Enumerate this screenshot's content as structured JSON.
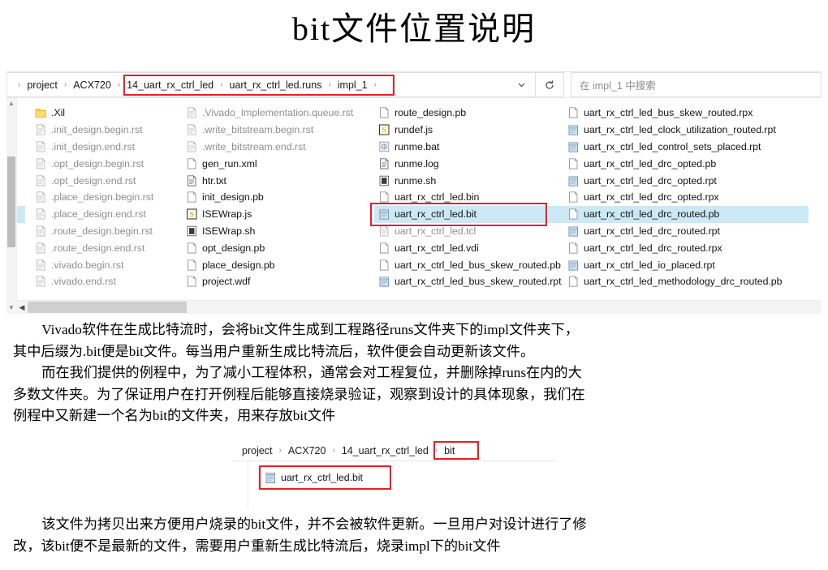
{
  "title": "bit文件位置说明",
  "explorer1": {
    "breadcrumbs": [
      {
        "label": "project",
        "highlighted": false
      },
      {
        "label": "ACX720",
        "highlighted": false
      },
      {
        "label": "14_uart_rx_ctrl_led",
        "highlighted": true
      },
      {
        "label": "uart_rx_ctrl_led.runs",
        "highlighted": true
      },
      {
        "label": "impl_1",
        "highlighted": true
      }
    ],
    "dropdown_icon": "chevron-down-icon",
    "refresh_icon": "refresh-icon",
    "search_placeholder": "在 impl_1 中搜索",
    "columns": [
      {
        "items": [
          {
            "name": ".Xil",
            "icon": "folder-icon",
            "dim": false
          },
          {
            "name": ".init_design.begin.rst",
            "icon": "rst-file-icon",
            "dim": true
          },
          {
            "name": ".init_design.end.rst",
            "icon": "rst-file-icon",
            "dim": true
          },
          {
            "name": ".opt_design.begin.rst",
            "icon": "rst-file-icon",
            "dim": true
          },
          {
            "name": ".opt_design.end.rst",
            "icon": "rst-file-icon",
            "dim": true
          },
          {
            "name": ".place_design.begin.rst",
            "icon": "rst-file-icon",
            "dim": true
          },
          {
            "name": ".place_design.end.rst",
            "icon": "rst-file-icon",
            "dim": true
          },
          {
            "name": ".route_design.begin.rst",
            "icon": "rst-file-icon",
            "dim": true
          },
          {
            "name": ".route_design.end.rst",
            "icon": "rst-file-icon",
            "dim": true
          },
          {
            "name": ".vivado.begin.rst",
            "icon": "rst-file-icon",
            "dim": true
          },
          {
            "name": ".vivado.end.rst",
            "icon": "rst-file-icon",
            "dim": true
          }
        ]
      },
      {
        "items": [
          {
            "name": ".Vivado_Implementation.queue.rst",
            "icon": "rst-file-icon",
            "dim": true
          },
          {
            "name": ".write_bitstream.begin.rst",
            "icon": "rst-file-icon",
            "dim": true
          },
          {
            "name": ".write_bitstream.end.rst",
            "icon": "rst-file-icon",
            "dim": true
          },
          {
            "name": "gen_run.xml",
            "icon": "blank-file-icon",
            "dim": false
          },
          {
            "name": "htr.txt",
            "icon": "text-file-icon",
            "dim": false
          },
          {
            "name": "init_design.pb",
            "icon": "blank-file-icon",
            "dim": false
          },
          {
            "name": "ISEWrap.js",
            "icon": "js-file-icon",
            "dim": false
          },
          {
            "name": "ISEWrap.sh",
            "icon": "sh-file-icon",
            "dim": false
          },
          {
            "name": "opt_design.pb",
            "icon": "blank-file-icon",
            "dim": false
          },
          {
            "name": "place_design.pb",
            "icon": "blank-file-icon",
            "dim": false
          },
          {
            "name": "project.wdf",
            "icon": "blank-file-icon",
            "dim": false
          }
        ]
      },
      {
        "items": [
          {
            "name": "route_design.pb",
            "icon": "blank-file-icon",
            "dim": false
          },
          {
            "name": "rundef.js",
            "icon": "js-file-icon",
            "dim": false
          },
          {
            "name": "runme.bat",
            "icon": "bat-file-icon",
            "dim": false
          },
          {
            "name": "runme.log",
            "icon": "text-file-icon",
            "dim": false
          },
          {
            "name": "runme.sh",
            "icon": "sh-file-icon",
            "dim": false
          },
          {
            "name": "uart_rx_ctrl_led.bin",
            "icon": "blank-file-icon",
            "dim": false
          },
          {
            "name": "uart_rx_ctrl_led.bit",
            "icon": "notepad-file-icon",
            "dim": false,
            "selected": true
          },
          {
            "name": "uart_rx_ctrl_led.tcl",
            "icon": "rst-file-icon",
            "dim": true
          },
          {
            "name": "uart_rx_ctrl_led.vdi",
            "icon": "blank-file-icon",
            "dim": false
          },
          {
            "name": "uart_rx_ctrl_led_bus_skew_routed.pb",
            "icon": "blank-file-icon",
            "dim": false
          },
          {
            "name": "uart_rx_ctrl_led_bus_skew_routed.rpt",
            "icon": "notepad-file-icon",
            "dim": false
          }
        ]
      },
      {
        "items": [
          {
            "name": "uart_rx_ctrl_led_bus_skew_routed.rpx",
            "icon": "blank-file-icon",
            "dim": false
          },
          {
            "name": "uart_rx_ctrl_led_clock_utilization_routed.rpt",
            "icon": "notepad-file-icon",
            "dim": false
          },
          {
            "name": "uart_rx_ctrl_led_control_sets_placed.rpt",
            "icon": "notepad-file-icon",
            "dim": false
          },
          {
            "name": "uart_rx_ctrl_led_drc_opted.pb",
            "icon": "blank-file-icon",
            "dim": false
          },
          {
            "name": "uart_rx_ctrl_led_drc_opted.rpt",
            "icon": "notepad-file-icon",
            "dim": false
          },
          {
            "name": "uart_rx_ctrl_led_drc_opted.rpx",
            "icon": "blank-file-icon",
            "dim": false
          },
          {
            "name": "uart_rx_ctrl_led_drc_routed.pb",
            "icon": "blank-file-icon",
            "dim": false,
            "selected": true
          },
          {
            "name": "uart_rx_ctrl_led_drc_routed.rpt",
            "icon": "notepad-file-icon",
            "dim": false
          },
          {
            "name": "uart_rx_ctrl_led_drc_routed.rpx",
            "icon": "blank-file-icon",
            "dim": false
          },
          {
            "name": "uart_rx_ctrl_led_io_placed.rpt",
            "icon": "notepad-file-icon",
            "dim": false
          },
          {
            "name": "uart_rx_ctrl_led_methodology_drc_routed.pb",
            "icon": "blank-file-icon",
            "dim": false
          }
        ]
      }
    ]
  },
  "paragraphs": {
    "p1_line1": "Vivado软件在生成比特流时，会将bit文件生成到工程路径runs文件夹下的impl文件夹下，",
    "p1_line2": "其中后缀为.bit便是bit文件。每当用户重新生成比特流后，软件便会自动更新该文件。",
    "p2_line1": "而在我们提供的例程中，为了减小工程体积，通常会对工程复位，并删除掉runs在内的大",
    "p2_line2": "多数文件夹。为了保证用户在打开例程后能够直接烧录验证，观察到设计的具体现象，我们在",
    "p2_line3": "例程中又新建一个名为bit的文件夹，用来存放bit文件",
    "p3_line1": "该文件为拷贝出来方便用户烧录的bit文件，并不会被软件更新。一旦用户对设计进行了修",
    "p3_line2": "改，该bit便不是最新的文件，需要用户重新生成比特流后，烧录impl下的bit文件"
  },
  "explorer2": {
    "breadcrumbs": [
      {
        "label": "project",
        "highlighted": false
      },
      {
        "label": "ACX720",
        "highlighted": false
      },
      {
        "label": "14_uart_rx_ctrl_led",
        "highlighted": false
      },
      {
        "label": "bit",
        "highlighted": true
      }
    ],
    "file": {
      "name": "uart_rx_ctrl_led.bit",
      "icon": "notepad-file-icon"
    }
  },
  "colors": {
    "highlight_red": "#ee1c25",
    "selection_blue": "#cce8f4",
    "folder_yellow": "#ffd04b",
    "text": "#141414",
    "dim_text": "#8f8f8f"
  }
}
